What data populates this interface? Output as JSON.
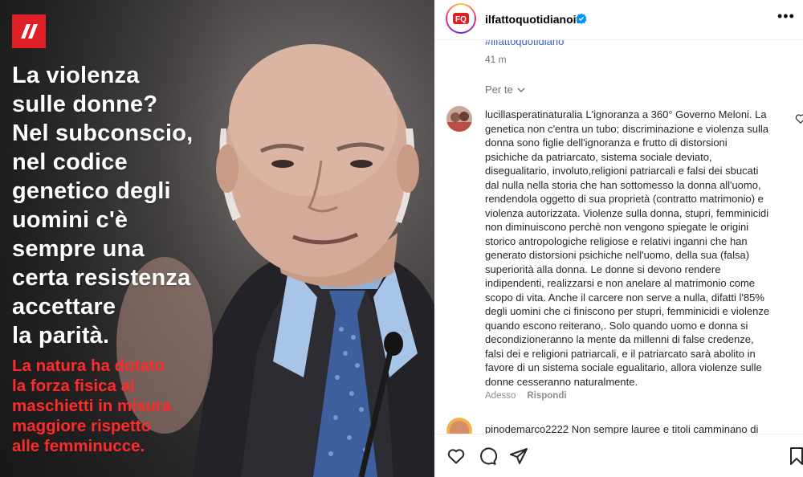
{
  "post": {
    "headline": "La violenza\nsulle donne?\nNel subconscio,\nnel codice\ngenetico degli\nuomini c'è\nsempre una\ncerta resistenza\naccettare\nla parità.",
    "subhead": "La natura ha dotato\nla forza fisica ai\nmaschietti in misura\nmaggiore rispetto\nalle femminucce.",
    "brand_color": "#e01e25",
    "headline_color": "#ffffff",
    "subhead_color": "#ff2a2a"
  },
  "header": {
    "username": "ilfattoquotidianoit",
    "verified": true,
    "more_icon": "more-horizontal-icon"
  },
  "caption": {
    "hashtag": "#ilfattoquotidiano",
    "time_ago": "41 m"
  },
  "comments_filter": {
    "label": "Per te",
    "icon": "chevron-down-icon"
  },
  "comments": [
    {
      "username": "lucillasperatinaturalia",
      "text": "L'ignoranza a 360° Governo Meloni. La genetica non c'entra un tubo; discriminazione e violenza sulla donna sono figlie dell'ignoranza e frutto di distorsioni psichiche da patriarcato, sistema sociale deviato, disegualitario, involuto,religioni patriarcali e falsi dei sbucati dal nulla nella storia che han sottomesso la donna all'uomo, rendendola oggetto di sua proprietà (contratto matrimonio) e violenza autorizzata. Violenze sulla donna, stupri, femminicidi non diminuiscono perchè non vengono spiegate le origini storico antropologiche religiose e relativi inganni che han generato distorsioni psichiche nell'uomo, della sua (falsa) superiorità alla donna. Le donne si devono rendere indipendenti, realizzarsi e non anelare al matrimonio come scopo di vita. Anche il carcere non serve a nulla, difatti l'85% degli uomini che ci finiscono per stupri, femminicidi e violenze quando escono reiterano,. Solo quando uomo e donna si decondizioneranno la mente da millenni di false credenze, falsi dei e religioni patriarcali, e il patriarcato sarà abolito in favore di un sistema sociale egualitario, allora violenze sulle donne cesseranno naturalmente.",
      "time": "Adesso",
      "reply_label": "Rispondi"
    },
    {
      "username": "pinodemarco2222",
      "text": "Non sempre lauree e titoli camminano di"
    }
  ],
  "actions": {
    "like": "heart-icon",
    "comment": "comment-icon",
    "share": "share-icon",
    "save": "bookmark-icon"
  }
}
